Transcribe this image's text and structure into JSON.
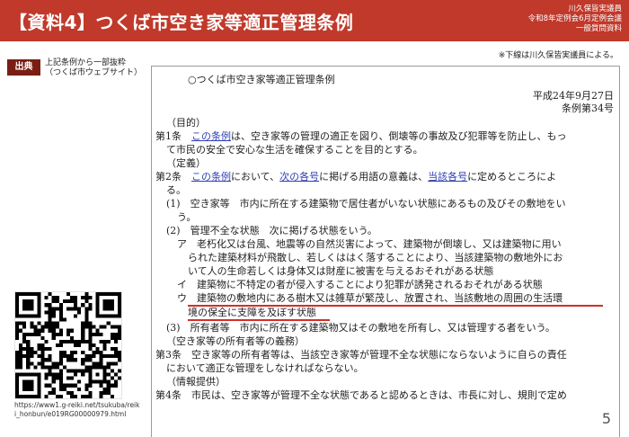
{
  "header": {
    "title": "【資料4】つくば市空き家等適正管理条例",
    "right_lines": [
      "川久保皆実議員",
      "令和8年定例会6月定例会議",
      "一般質問資料"
    ]
  },
  "note": "※下線は川久保皆実議員による。",
  "source": {
    "label": "出典",
    "lines": [
      "上記条例から一部抜粋",
      "（つくば市ウェブサイト）"
    ]
  },
  "qr": {
    "url": "https://www1.g-reiki.net/tsukuba/reiki_honbun/e019RG00000979.html"
  },
  "page_number": "5",
  "document": {
    "title": "○つくば市空き家等適正管理条例",
    "date": "平成24年9月27日",
    "number": "条例第34号",
    "lines": [
      "（目的）",
      {
        "pre": "第1条　",
        "link": "この条例",
        "post": "は、空き家等の管理の適正を図り、倒壊等の事故及び犯罪等を防止し、もっ"
      },
      "て市民の安全で安心な生活を確保することを目的とする。",
      "（定義）",
      {
        "pre": "第2条　",
        "link": "この条例",
        "mid": "において、",
        "link2": "次の各号",
        "mid2": "に掲げる用語の意義は、",
        "link3": "当該各号",
        "post": "に定めるところによ"
      },
      "る。",
      "(1)　空き家等　市内に所在する建築物で居住者がいない状態にあるもの及びその敷地をい",
      "う。",
      "(2)　管理不全な状態　次に掲げる状態をいう。",
      "ア　老朽化又は台風、地震等の自然災害によって、建築物が倒壊し、又は建築物に用い",
      "られた建築材料が飛散し、若しくははく落することにより、当該建築物の敷地外にお",
      "いて人の生命若しくは身体又は財産に被害を与えるおそれがある状態",
      "イ　建築物に不特定の者が侵入することにより犯罪が誘発されるおそれがある状態",
      "ウ　建築物の敷地内にある樹木又は雑草が繁茂し、放置され、当該敷地の周囲の生活環",
      "境の保全に支障を及ぼす状態",
      "(3)　所有者等　市内に所在する建築物又はその敷地を所有し、又は管理する者をいう。",
      "（空き家等の所有者等の義務）",
      "第3条　空き家等の所有者等は、当該空き家等が管理不全な状態にならないように自らの責任",
      "において適正な管理をしなければならない。",
      "（情報提供）",
      "第4条　市民は、空き家等が管理不全な状態であると認めるときは、市長に対し、規則で定め"
    ]
  }
}
